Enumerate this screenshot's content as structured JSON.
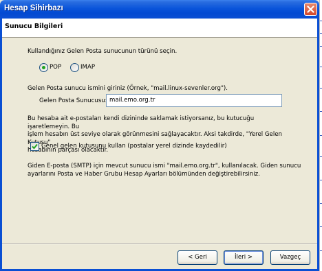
{
  "window": {
    "title": "Hesap Sihirbazı"
  },
  "header": {
    "title": "Sunucu Bilgileri"
  },
  "server_type": {
    "prompt": "Kullandığınız Gelen Posta sunucunun türünü seçin.",
    "options": [
      {
        "label": "POP",
        "selected": true
      },
      {
        "label": "IMAP",
        "selected": false
      }
    ]
  },
  "incoming": {
    "prompt": "Gelen Posta sunucu ismini giriniz (Örnek, \"mail.linux-sevenler.org\").",
    "field_label": "Gelen Posta Sunucusu:",
    "field_value": "mail.emo.org.tr"
  },
  "global_inbox": {
    "description_lines": [
      "Bu hesaba ait e-postaları kendi dizininde saklamak istiyorsanız, bu kutucuğu işaretlemeyin. Bu",
      "işlem hesabın üst seviye olarak görünmesini sağlayacaktır. Aksi takdirde, \"Yerel Gelen Kutusu\"",
      "hesabının parçası olacaktır."
    ],
    "checkbox_label": "Genel gelen kutusunu kullan (postalar yerel dizinde kaydedilir)",
    "checked": true
  },
  "outgoing": {
    "lines": [
      "Giden E-posta (SMTP) için mevcut sunucu ismi \"mail.emo.org.tr\", kullanılacak. Giden sunucu",
      "ayarlarını Posta ve Haber Grubu Hesap Ayarları bölümünden değiştirebilirsiniz."
    ]
  },
  "buttons": {
    "back": "< Geri",
    "next": "İleri >",
    "cancel": "Vazgeç"
  },
  "colors": {
    "title_bar": "#0b55da",
    "dialog_bg": "#ece9d8",
    "radio_dot": "#21a121"
  }
}
